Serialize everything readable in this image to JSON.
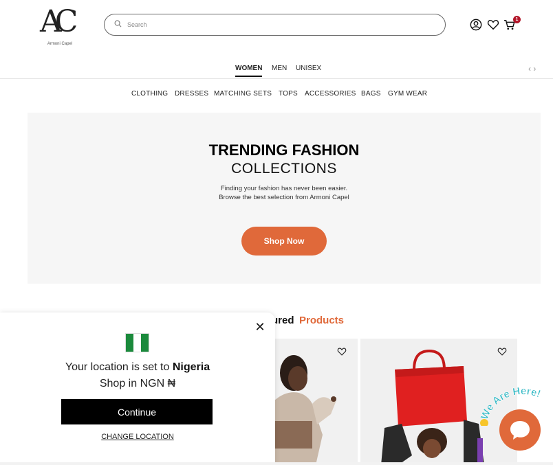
{
  "header": {
    "logo_monogram": "AC",
    "logo_brand": "Armoni Capel",
    "search_placeholder": "Search",
    "cart_count": "1"
  },
  "gender_tabs": [
    {
      "label": "WOMEN",
      "active": true
    },
    {
      "label": "MEN",
      "active": false
    },
    {
      "label": "UNISEX",
      "active": false
    }
  ],
  "categories": [
    "CLOTHING",
    "DRESSES",
    "MATCHING SETS",
    "TOPS",
    "ACCESSORIES",
    "BAGS",
    "GYM WEAR"
  ],
  "hero": {
    "title": "TRENDING FASHION",
    "subtitle": "COLLECTIONS",
    "text": "Finding your fashion has never been easier. Browse the best selection from Armoni Capel",
    "button": "Shop Now"
  },
  "featured": {
    "title_partial": "ured",
    "title_accent": "Products"
  },
  "location_modal": {
    "line1_prefix": "Your location is set to",
    "country": "Nigeria",
    "line2": "Shop in NGN ₦",
    "continue": "Continue",
    "change": "CHANGE LOCATION"
  },
  "chat": {
    "badge": "We Are Here!"
  },
  "colors": {
    "accent": "#e0693a",
    "badge": "#b3172a",
    "flag_green": "#1b8a3c"
  }
}
